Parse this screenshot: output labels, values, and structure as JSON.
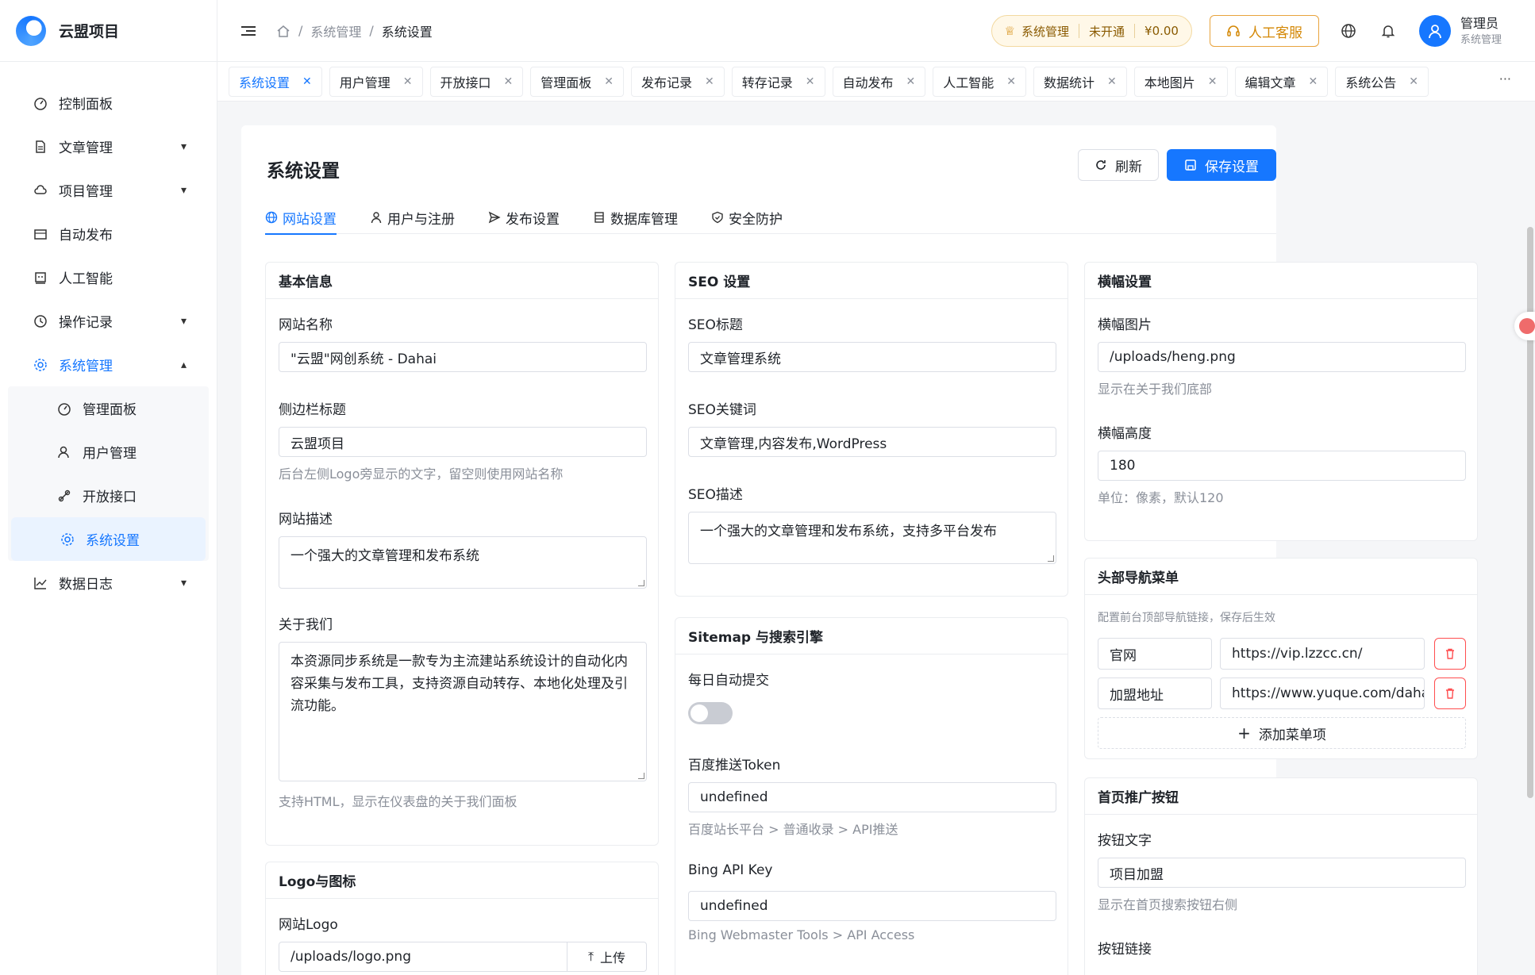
{
  "app": {
    "name": "云盟项目"
  },
  "sidebar": {
    "items": [
      {
        "label": "控制面板",
        "icon": "dashboard-icon"
      },
      {
        "label": "文章管理",
        "icon": "document-icon"
      },
      {
        "label": "项目管理",
        "icon": "cloud-icon"
      },
      {
        "label": "自动发布",
        "icon": "calendar-icon"
      },
      {
        "label": "人工智能",
        "icon": "robot-icon"
      },
      {
        "label": "操作记录",
        "icon": "history-icon"
      },
      {
        "label": "系统管理",
        "icon": "gear-icon"
      },
      {
        "label": "数据日志",
        "icon": "chart-icon"
      }
    ],
    "sub_items": [
      {
        "label": "管理面板",
        "icon": "dashboard-icon"
      },
      {
        "label": "用户管理",
        "icon": "users-icon"
      },
      {
        "label": "开放接口",
        "icon": "api-icon"
      },
      {
        "label": "系统设置",
        "icon": "gear-icon"
      }
    ]
  },
  "header": {
    "breadcrumb": [
      "系统管理",
      "系统设置"
    ],
    "vip": {
      "module": "系统管理",
      "status": "未开通",
      "balance": "¥0.00"
    },
    "service_label": "人工客服",
    "user": {
      "name": "管理员",
      "role": "系统管理"
    }
  },
  "tabs": [
    "系统设置",
    "用户管理",
    "开放接口",
    "管理面板",
    "发布记录",
    "转存记录",
    "自动发布",
    "人工智能",
    "数据统计",
    "本地图片",
    "编辑文章",
    "系统公告"
  ],
  "page": {
    "title": "系统设置",
    "refresh_label": "刷新",
    "save_label": "保存设置",
    "settings_tabs": [
      "网站设置",
      "用户与注册",
      "发布设置",
      "数据库管理",
      "安全防护"
    ]
  },
  "basic": {
    "title": "基本信息",
    "site_name_label": "网站名称",
    "site_name": "\"云盟\"网创系统 - Dahai",
    "sidebar_title_label": "侧边栏标题",
    "sidebar_title": "云盟项目",
    "sidebar_title_hint": "后台左侧Logo旁显示的文字，留空则使用网站名称",
    "desc_label": "网站描述",
    "desc": "一个强大的文章管理和发布系统",
    "about_label": "关于我们",
    "about": "本资源同步系统是一款专为主流建站系统设计的自动化内容采集与发布工具，支持资源自动转存、本地化处理及引流功能。",
    "about_hint": "支持HTML，显示在仪表盘的关于我们面板"
  },
  "logo": {
    "title": "Logo与图标",
    "site_logo_label": "网站Logo",
    "site_logo": "/uploads/logo.png",
    "upload_label": "上传"
  },
  "seo": {
    "title": "SEO 设置",
    "seo_title_label": "SEO标题",
    "seo_title": "文章管理系统",
    "keywords_label": "SEO关键词",
    "keywords": "文章管理,内容发布,WordPress",
    "desc_label": "SEO描述",
    "desc": "一个强大的文章管理和发布系统，支持多平台发布"
  },
  "sitemap": {
    "title": "Sitemap 与搜索引擎",
    "auto_submit_label": "每日自动提交",
    "auto_submit": false,
    "baidu_label": "百度推送Token",
    "baidu_value": "undefined",
    "baidu_hint": "百度站长平台 > 普通收录 > API推送",
    "bing_label": "Bing API Key",
    "bing_value": "undefined",
    "bing_hint": "Bing Webmaster Tools > API Access"
  },
  "banner": {
    "title": "横幅设置",
    "image_label": "横幅图片",
    "image": "/uploads/heng.png",
    "image_hint": "显示在关于我们底部",
    "height_label": "横幅高度",
    "height": "180",
    "height_hint": "单位：像素，默认120"
  },
  "nav": {
    "title": "头部导航菜单",
    "hint": "配置前台顶部导航链接，保存后生效",
    "items": [
      {
        "name": "官网",
        "url": "https://vip.lzzcc.cn/"
      },
      {
        "name": "加盟地址",
        "url": "https://www.yuque.com/daha"
      }
    ],
    "add_label": "添加菜单项"
  },
  "promo": {
    "title": "首页推广按钮",
    "text_label": "按钮文字",
    "text": "项目加盟",
    "text_hint": "显示在首页搜索按钮右侧",
    "link_label": "按钮链接"
  },
  "colors": {
    "primary": "#1677ff",
    "danger": "#ff4d4f",
    "warning": "#d48806"
  }
}
